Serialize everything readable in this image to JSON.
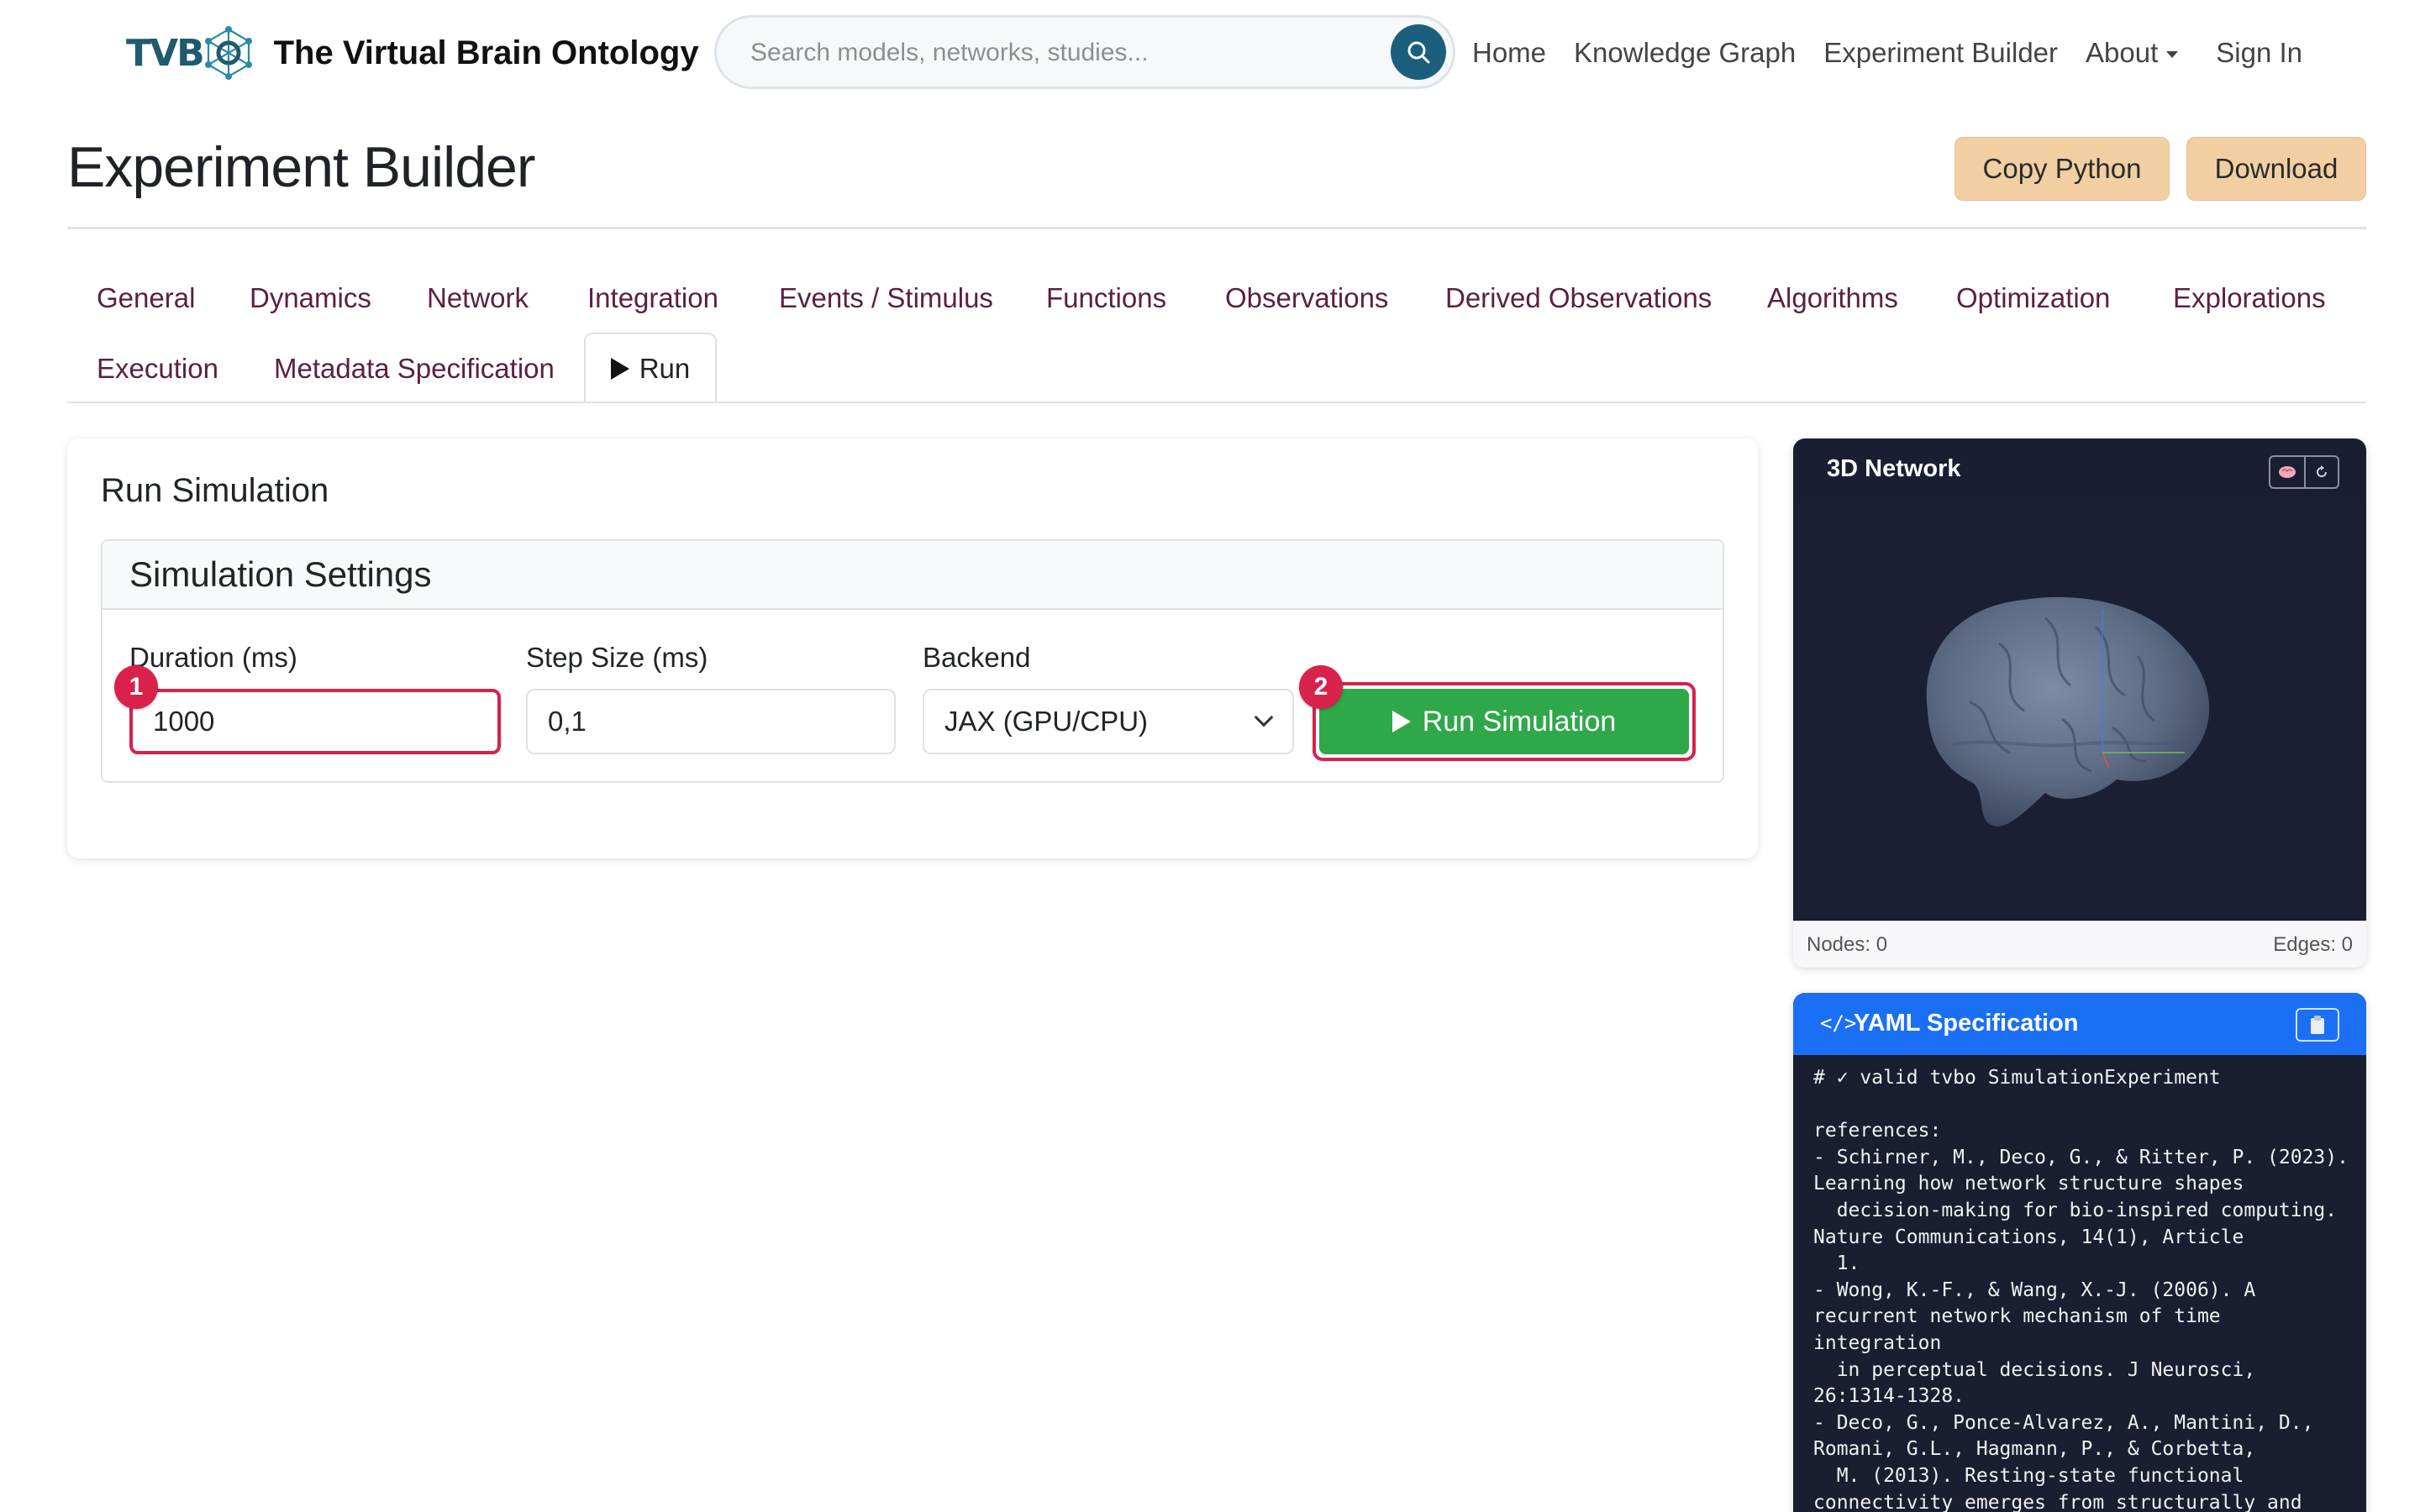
{
  "navbar": {
    "logo_text": "TVB",
    "brand_title": "The Virtual Brain Ontology",
    "search_placeholder": "Search models, networks, studies...",
    "links": [
      "Home",
      "Knowledge Graph",
      "Experiment Builder",
      "About",
      "Sign In"
    ]
  },
  "header": {
    "title": "Experiment Builder",
    "copy_python": "Copy Python",
    "download": "Download"
  },
  "tabs": {
    "row1": [
      "General",
      "Dynamics",
      "Network",
      "Integration",
      "Events / Stimulus",
      "Functions",
      "Observations",
      "Derived Observations",
      "Algorithms",
      "Optimization",
      "Explorations"
    ],
    "row2": [
      "Execution",
      "Metadata Specification"
    ],
    "active": "Run"
  },
  "run": {
    "card_title": "Run Simulation",
    "settings_title": "Simulation Settings",
    "duration_label": "Duration (ms)",
    "duration_value": "1000",
    "step_label": "Step Size (ms)",
    "step_value": "0,1",
    "backend_label": "Backend",
    "backend_value": "JAX (GPU/CPU)",
    "run_button": "Run Simulation",
    "badge_1": "1",
    "badge_2": "2"
  },
  "network": {
    "title": "3D Network",
    "nodes": "Nodes: 0",
    "edges": "Edges: 0"
  },
  "yaml": {
    "title": "YAML Specification",
    "lines": [
      "# ✓ valid tvbo SimulationExperiment",
      "",
      "references:",
      "- Schirner, M., Deco, G., & Ritter, P. (2023).",
      "Learning how network structure shapes",
      "  decision-making for bio-inspired computing.",
      "Nature Communications, 14(1), Article",
      "  1.",
      "- Wong, K.-F., & Wang, X.-J. (2006). A",
      "recurrent network mechanism of time",
      "integration",
      "  in perceptual decisions. J Neurosci,",
      "26:1314-1328.",
      "- Deco, G., Ponce-Alvarez, A., Mantini, D.,",
      "Romani, G.L., Hagmann, P., & Corbetta,",
      "  M. (2013). Resting-state functional",
      "connectivity emerges from structurally and"
    ]
  },
  "colors": {
    "accent_tab": "#5b2140",
    "header_button": "#f2cfa2",
    "run_green": "#2fa84a",
    "highlight_red": "#d8214b",
    "yaml_blue": "#1b6ff5",
    "dark_panel": "#191e33"
  },
  "icons": [
    "tvb-network-logo-icon",
    "search-icon",
    "caret-down-icon",
    "play-icon",
    "chevron-down-icon",
    "brain-icon",
    "reset-view-icon",
    "code-icon",
    "clipboard-icon"
  ]
}
